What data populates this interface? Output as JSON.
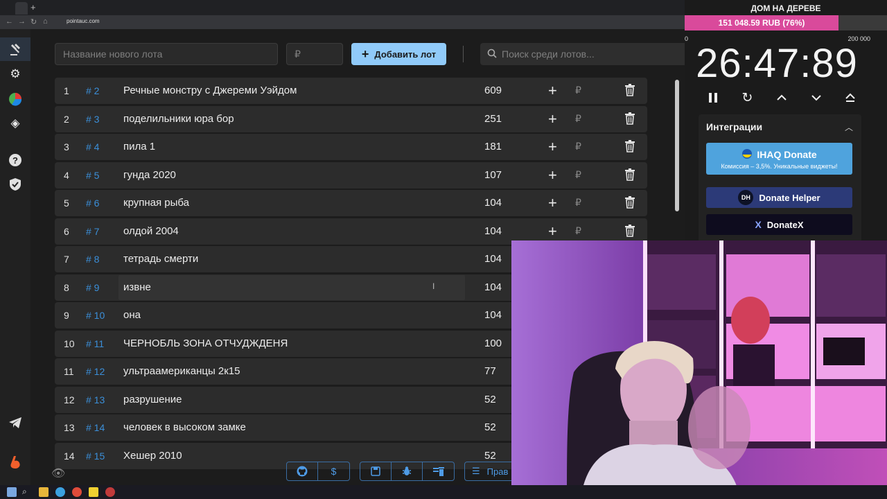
{
  "browser": {
    "url": "pointauc.com"
  },
  "controls": {
    "lot_name_placeholder": "Название нового лота",
    "amount_placeholder": "₽",
    "add_button_label": "Добавить лот",
    "search_placeholder": "Поиск среди лотов..."
  },
  "lots": [
    {
      "index": "1",
      "id": "# 2",
      "name": "Речные монстру с Джереми Уэйдом",
      "amount": "609"
    },
    {
      "index": "2",
      "id": "# 3",
      "name": "поделильники юра бор",
      "amount": "251"
    },
    {
      "index": "3",
      "id": "# 4",
      "name": "пила 1",
      "amount": "181"
    },
    {
      "index": "4",
      "id": "# 5",
      "name": "гунда 2020",
      "amount": "107"
    },
    {
      "index": "5",
      "id": "# 6",
      "name": "крупная рыба",
      "amount": "104"
    },
    {
      "index": "6",
      "id": "# 7",
      "name": "олдой 2004",
      "amount": "104"
    },
    {
      "index": "7",
      "id": "# 8",
      "name": "тетрадь смерти",
      "amount": "104"
    },
    {
      "index": "8",
      "id": "# 9",
      "name": "извне",
      "amount": "104"
    },
    {
      "index": "9",
      "id": "# 10",
      "name": "она",
      "amount": "104"
    },
    {
      "index": "10",
      "id": "# 11",
      "name": "ЧЕРНОБЛЬ ЗОНА ОТЧУДЖДЕНЯ",
      "amount": "100"
    },
    {
      "index": "11",
      "id": "# 12",
      "name": "ультраамериканцы 2к15",
      "amount": "77"
    },
    {
      "index": "12",
      "id": "# 13",
      "name": "разрушение",
      "amount": "52"
    },
    {
      "index": "13",
      "id": "# 14",
      "name": "человек в высоком замке",
      "amount": "52"
    },
    {
      "index": "14",
      "id": "# 15",
      "name": "Хешер 2010",
      "amount": "52"
    }
  ],
  "lot_actions": {
    "plus": "+",
    "rub": "₽",
    "more": "•••"
  },
  "bottom_bar": {
    "rules_label": "Прав"
  },
  "panel": {
    "title": "ДОМ НА ДЕРЕВЕ",
    "progress_text": "151 048.59 RUB (76%)",
    "progress_fraction": 0.76,
    "scale_min": "0",
    "scale_max": "200 000",
    "timer": "26:47:89"
  },
  "integrations": {
    "header": "Интеграции",
    "donate1_label": "IHAQ Donate",
    "donate1_sub": "Комиссия – 3,5%. Уникальные виджеты!",
    "donate2_label": "Donate Helper",
    "donate2_badge": "DH",
    "donate3_label": "DonateX",
    "donate3_badge": "X"
  },
  "colors": {
    "accent": "#90caf9",
    "progress_fill": "#d94a9b",
    "lot_id": "#3b8fd9"
  }
}
